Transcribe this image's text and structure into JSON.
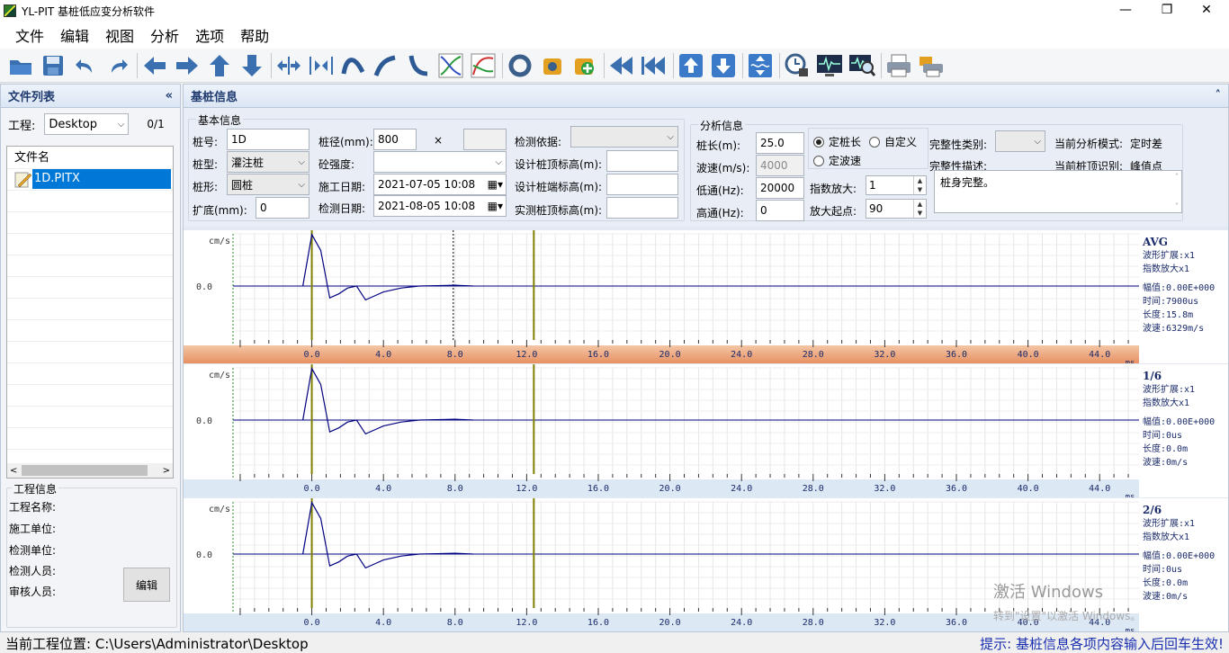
{
  "titlebar": {
    "title": "YL-PIT 基桩低应变分析软件",
    "min": "—",
    "max": "❐",
    "close": "✕"
  },
  "menu": [
    "文件",
    "编辑",
    "视图",
    "分析",
    "选项",
    "帮助"
  ],
  "toolbar": {
    "icons": [
      "open-folder-icon",
      "save-icon",
      "undo-icon",
      "redo-icon",
      "arrow-left-icon",
      "arrow-right-icon",
      "arrow-up-icon",
      "arrow-down-icon",
      "compress-h-icon",
      "expand-h-icon",
      "curve-a-icon",
      "curve-b-icon",
      "curve-c-icon",
      "chart-a-icon",
      "chart-b-icon",
      "ring-icon",
      "gear-a-icon",
      "gear-add-icon",
      "rewind-icon",
      "fast-back-icon",
      "move-up-icon",
      "move-down-icon",
      "vscale-icon",
      "clock-lock-icon",
      "monitor-wave-icon",
      "monitor-zoom-icon",
      "printer-icon",
      "print-setup-icon"
    ]
  },
  "left": {
    "title": "文件列表",
    "collapse": "«",
    "project_label": "工程:",
    "project_value": "Desktop",
    "count": "0/1",
    "file_header": "文件名",
    "file_item": "1D.PITX",
    "info_title": "工程信息",
    "info_labels": [
      "工程名称:",
      "施工单位:",
      "检测单位:",
      "检测人员:",
      "审核人员:"
    ],
    "edit_label": "编辑"
  },
  "pile": {
    "title": "基桩信息",
    "collapse": "˄",
    "basic_title": "基本信息",
    "no_label": "桩号:",
    "no_value": "1D",
    "diam_label": "桩径(mm):",
    "diam_value": "800",
    "x": "×",
    "diam2_value": "",
    "basis_label": "检测依据:",
    "basis_value": "",
    "type_label": "桩型:",
    "type_value": "灌注桩",
    "conc_label": "砼强度:",
    "conc_value": "",
    "top_elev_label": "设计桩顶标高(m):",
    "top_elev_value": "",
    "shape_label": "桩形:",
    "shape_value": "圆桩",
    "build_label": "施工日期:",
    "build_value": "2021-07-05 10:08",
    "end_elev_label": "设计桩端标高(m):",
    "end_elev_value": "",
    "expand_label": "扩底(mm):",
    "expand_value": "0",
    "test_label": "检测日期:",
    "test_value": "2021-08-05 10:08",
    "real_top_label": "实测桩顶标高(m):",
    "real_top_value": "",
    "analysis_title": "分析信息",
    "len_label": "桩长(m):",
    "len_value": "25.0",
    "radio1": "定桩长",
    "radio2": "自定义",
    "radio3": "定波速",
    "speed_label": "波速(m/s):",
    "speed_value": "4000",
    "low_label": "低通(Hz):",
    "low_value": "20000",
    "gain_label": "指数放大:",
    "gain_value": "1",
    "high_label": "高通(Hz):",
    "high_value": "0",
    "start_label": "放大起点:",
    "start_value": "90",
    "integ_class_label": "完整性类别:",
    "integ_class_value": "",
    "mode_label": "当前分析模式:",
    "mode_value": "定时差",
    "integ_desc_label": "完整性描述:",
    "top_id_label": "当前桩顶识别:",
    "top_id_value": "峰值点",
    "desc_value": "桩身完整。"
  },
  "chart_data": [
    {
      "type": "line",
      "name": "AVG",
      "ylabel": "cm/s",
      "ytick": "0.0",
      "xlabel": "ms",
      "xticks": [
        "0.0",
        "4.0",
        "8.0",
        "12.0",
        "16.0",
        "20.0",
        "24.0",
        "28.0",
        "32.0",
        "36.0",
        "40.0",
        "44.0"
      ],
      "xlim": [
        -4.4,
        46.2
      ],
      "x": [
        -0.5,
        0.0,
        0.5,
        1.0,
        1.5,
        2.0,
        2.5,
        3.0,
        3.5,
        4.0,
        5.0,
        6.0,
        7.0,
        8.0,
        9.0
      ],
      "y": [
        0.0,
        2.6,
        1.8,
        -0.6,
        -0.4,
        -0.1,
        0.0,
        -0.7,
        -0.5,
        -0.3,
        -0.1,
        0.0,
        0.02,
        0.04,
        0.0
      ],
      "markers": [
        0.0,
        12.4
      ],
      "dashed": [
        7.9
      ],
      "side": [
        "AVG",
        "波形扩展:x1",
        "指数放大x1",
        "幅值:0.00E+000",
        "时间:7900us",
        "长度:15.8m",
        "波速:6329m/s"
      ]
    },
    {
      "type": "line",
      "name": "1/6",
      "ylabel": "cm/s",
      "ytick": "0.0",
      "xlabel": "ms",
      "xticks": [
        "0.0",
        "4.0",
        "8.0",
        "12.0",
        "16.0",
        "20.0",
        "24.0",
        "28.0",
        "32.0",
        "36.0",
        "40.0",
        "44.0"
      ],
      "xlim": [
        -4.4,
        46.2
      ],
      "x": [
        -0.5,
        0.0,
        0.5,
        1.0,
        1.5,
        2.0,
        2.5,
        3.0,
        3.5,
        4.0,
        5.0,
        6.0,
        7.0,
        8.0,
        9.0
      ],
      "y": [
        0.0,
        2.6,
        1.8,
        -0.6,
        -0.4,
        -0.1,
        0.0,
        -0.7,
        -0.5,
        -0.3,
        -0.1,
        0.0,
        0.02,
        0.04,
        0.0
      ],
      "markers": [
        0.0,
        12.4
      ],
      "dashed": [],
      "side": [
        "1/6",
        "波形扩展:x1",
        "指数放大x1",
        "幅值:0.00E+000",
        "时间:0us",
        "长度:0.0m",
        "波速:0m/s"
      ]
    },
    {
      "type": "line",
      "name": "2/6",
      "ylabel": "cm/s",
      "ytick": "0.0",
      "xlabel": "ms",
      "xticks": [
        "0.0",
        "4.0",
        "8.0",
        "12.0",
        "16.0",
        "20.0",
        "24.0",
        "28.0",
        "32.0",
        "36.0",
        "40.0",
        "44.0"
      ],
      "xlim": [
        -4.4,
        46.2
      ],
      "x": [
        -0.5,
        0.0,
        0.5,
        1.0,
        1.5,
        2.0,
        2.5,
        3.0,
        3.5,
        4.0,
        5.0,
        6.0,
        7.0,
        8.0,
        9.0
      ],
      "y": [
        0.0,
        2.6,
        1.8,
        -0.6,
        -0.4,
        -0.1,
        0.0,
        -0.7,
        -0.5,
        -0.3,
        -0.1,
        0.0,
        0.02,
        0.04,
        0.0
      ],
      "markers": [
        0.0,
        12.4
      ],
      "dashed": [],
      "side": [
        "2/6",
        "波形扩展:x1",
        "指数放大x1",
        "幅值:0.00E+000",
        "时间:0us",
        "长度:0.0m",
        "波速:0m/s"
      ]
    }
  ],
  "status": {
    "location": "当前工程位置:  C:\\Users\\Administrator\\Desktop",
    "hint": "提示:  基桩信息各项内容输入后回车生效!"
  },
  "watermark": {
    "line1": "激活 Windows",
    "line2": "转到\"设置\"以激活 Windows。"
  },
  "colors": {
    "accent": "#0078d7",
    "wave": "#000080",
    "marker": "#808000",
    "header_text": "#1e3a6e"
  }
}
